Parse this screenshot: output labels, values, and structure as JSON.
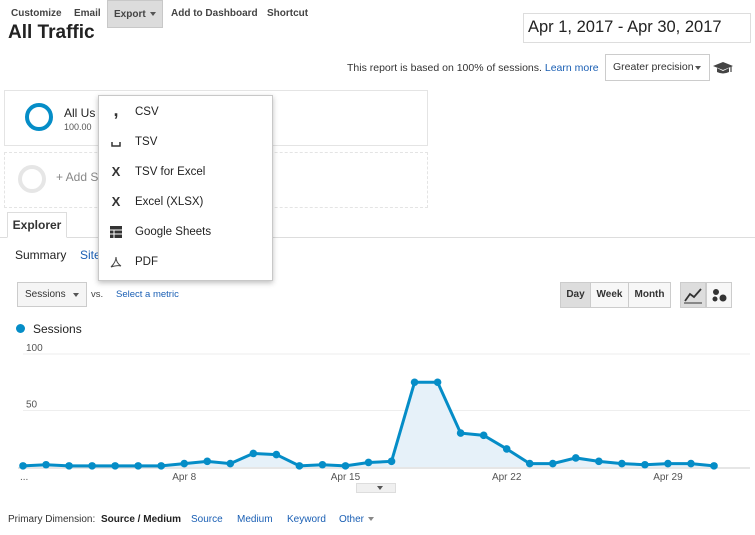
{
  "header": {
    "title": "All Traffic",
    "date_range": "Apr 1, 2017 - Apr 30, 2017"
  },
  "toolbar": {
    "customize": "Customize",
    "email": "Email",
    "export": "Export",
    "add_dashboard": "Add to Dashboard",
    "shortcut": "Shortcut",
    "sampling_note": "This report is based on 100% of sessions.",
    "learn_more": "Learn more",
    "precision": "Greater precision"
  },
  "segments": {
    "seg1_label": "All Us",
    "seg1_sub": "100.00",
    "add_segment": "+ Add S"
  },
  "tabs": {
    "explorer": "Explorer",
    "summary": "Summary",
    "site_usage": "Site"
  },
  "export_menu": {
    "items": [
      {
        "label": "CSV",
        "icon": "comma-icon"
      },
      {
        "label": "TSV",
        "icon": "tab-icon"
      },
      {
        "label": "TSV for Excel",
        "icon": "excel-icon"
      },
      {
        "label": "Excel (XLSX)",
        "icon": "excel-icon"
      },
      {
        "label": "Google Sheets",
        "icon": "sheets-icon"
      },
      {
        "label": "PDF",
        "icon": "pdf-icon"
      }
    ]
  },
  "chart_controls": {
    "metric": "Sessions",
    "vs": "vs.",
    "select_metric": "Select a metric",
    "day": "Day",
    "week": "Week",
    "month": "Month"
  },
  "chart_data": {
    "type": "area",
    "series": [
      {
        "name": "Sessions",
        "color": "#058dc7",
        "values": [
          1,
          2,
          1,
          1,
          1,
          1,
          1,
          3,
          5,
          3,
          12,
          11,
          1,
          2,
          1,
          4,
          5,
          75,
          75,
          30,
          28,
          16,
          3,
          3,
          8,
          5,
          3,
          2,
          3,
          3,
          1
        ]
      }
    ],
    "x_tick_labels": [
      "...",
      "Apr 8",
      "Apr 15",
      "Apr 22",
      "Apr 29"
    ],
    "y_tick_labels": [
      "100",
      "50"
    ],
    "ylim": [
      0,
      100
    ],
    "grid": true
  },
  "primary_dimension": {
    "label": "Primary Dimension:",
    "active": "Source / Medium",
    "options": [
      "Source",
      "Medium",
      "Keyword"
    ],
    "other": "Other"
  }
}
